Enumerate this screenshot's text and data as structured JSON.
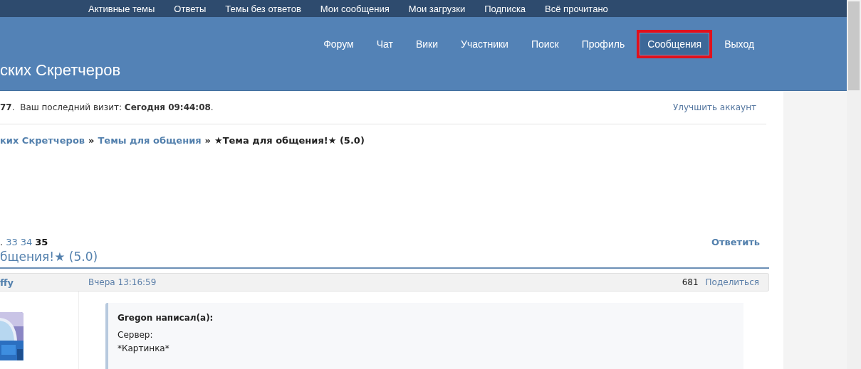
{
  "top_links": [
    "Активные темы",
    "Ответы",
    "Темы без ответов",
    "Мои сообщения",
    "Мои загрузки",
    "Подписка",
    "Всё прочитано"
  ],
  "header": {
    "site_title": "ских Скретчеров",
    "nav": [
      {
        "label": "Форум",
        "selected": false,
        "annotated": false
      },
      {
        "label": "Чат",
        "selected": false,
        "annotated": false
      },
      {
        "label": "Вики",
        "selected": false,
        "annotated": false
      },
      {
        "label": "Участники",
        "selected": false,
        "annotated": false
      },
      {
        "label": "Поиск",
        "selected": false,
        "annotated": false
      },
      {
        "label": "Профиль",
        "selected": false,
        "annotated": false
      },
      {
        "label": "Сообщения",
        "selected": true,
        "annotated": true
      },
      {
        "label": "Выход",
        "selected": false,
        "annotated": false
      }
    ]
  },
  "status_line": {
    "text": "**77**.  Ваш последний визит: **Сегодня 09:44:08**.",
    "upgrade_link": "Улучшить аккаунт"
  },
  "breadcrumbs": [
    {
      "label": "ких Скретчеров",
      "kind": "link"
    },
    {
      "label": "»",
      "kind": "separator"
    },
    {
      "label": "Темы для общения",
      "kind": "link"
    },
    {
      "label": "»",
      "kind": "separator"
    },
    {
      "label": "★Тема для общения!★ (5.0)",
      "kind": "current"
    }
  ],
  "pagination": [
    {
      "label": ".",
      "kind": "text"
    },
    {
      "label": "33",
      "kind": "link"
    },
    {
      "label": "34",
      "kind": "link"
    },
    {
      "label": "35",
      "kind": "current"
    }
  ],
  "reply_link": "Ответить",
  "topic_title": "бщения!★ (5.0)",
  "post": {
    "author": "ffy",
    "time": "Вчера 13:16:59",
    "number": "681",
    "share": "Поделиться",
    "quote": {
      "author": "Gregon написал(а):",
      "lines": [
        "Сервер:",
        "*Картинка*"
      ]
    }
  }
}
